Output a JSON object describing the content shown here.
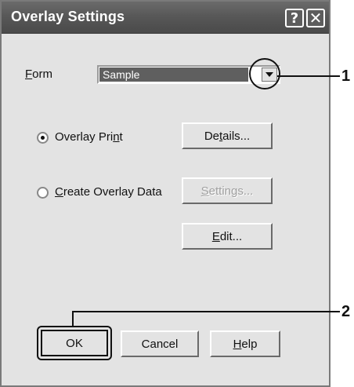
{
  "dialog": {
    "title": "Overlay Settings",
    "help_glyph": "?",
    "close_glyph": "✕"
  },
  "form": {
    "label": "Form",
    "mnemonic": "F",
    "rest": "orm",
    "selected": "Sample"
  },
  "overlay_print": {
    "label_pre": "Overlay Pri",
    "mnemonic": "n",
    "label_post": "t",
    "checked": true
  },
  "create_overlay": {
    "label_pre": "",
    "mnemonic": "C",
    "label_post": "reate Overlay Data",
    "checked": false
  },
  "buttons": {
    "details_pre": "De",
    "details_mnemonic": "t",
    "details_post": "ails...",
    "settings_mnemonic": "S",
    "settings_post": "ettings...",
    "edit_mnemonic": "E",
    "edit_post": "dit...",
    "ok": "OK",
    "cancel": "Cancel",
    "help_mnemonic": "H",
    "help_post": "elp"
  },
  "callouts": {
    "one": "1",
    "two": "2"
  }
}
